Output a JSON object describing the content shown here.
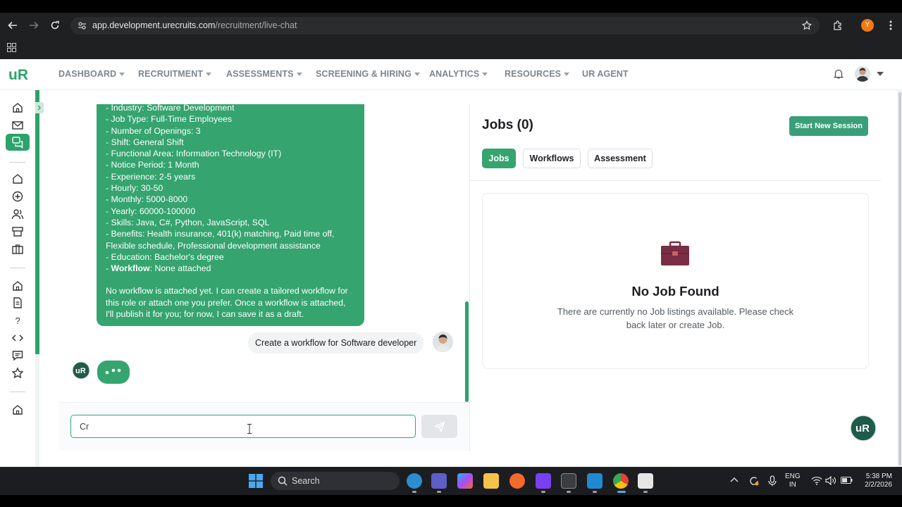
{
  "browser": {
    "url_host": "app.development.urecruits.com",
    "url_path": "/recruitment/live-chat",
    "profile_initial": "Y"
  },
  "nav": {
    "items": [
      {
        "label": "DASHBOARD"
      },
      {
        "label": "RECRUITMENT"
      },
      {
        "label": "ASSESSMENTS"
      },
      {
        "label": "SCREENING & HIRING"
      },
      {
        "label": "ANALYTICS"
      },
      {
        "label": "RESOURCES"
      },
      {
        "label": "UR AGENT"
      }
    ]
  },
  "chat": {
    "bubble_lines": [
      "- Industry: Software Development",
      "- Job Type: Full-Time Employees",
      "- Number of Openings: 3",
      "- Shift: General Shift",
      "- Functional Area: Information Technology (IT)",
      "- Notice Period: 1 Month",
      "- Experience: 2-5 years",
      "- Hourly: 30-50",
      "- Monthly: 5000-8000",
      "- Yearly: 60000-100000",
      "- Skills: Java, C#, Python, JavaScript, SQL",
      "- Benefits: Health insurance, 401(k) matching, Paid time off,",
      "Flexible schedule, Professional development assistance",
      "- Education: Bachelor's degree"
    ],
    "workflow_prefix": "- ",
    "workflow_key": "Workflow",
    "workflow_value": ": None attached",
    "bubble_paragraph": "No workflow is attached yet. I can create a tailored workflow for this role or attach one you prefer. Once a workflow is attached, I'll publish it for you; for now, I can save it as a draft.",
    "user_message": "Create a workflow for Software developer",
    "input_value": "Cr"
  },
  "jobs": {
    "title": "Jobs (0)",
    "new_session_label": "Start New Session",
    "tabs": [
      "Jobs",
      "Workflows",
      "Assessment"
    ],
    "active_tab": "Jobs",
    "empty_title": "No Job Found",
    "empty_desc": "There are currently no Job listings available. Please check back later or create Job."
  },
  "taskbar": {
    "search_label": "Search",
    "lang_1": "ENG",
    "lang_2": "IN",
    "time": "5:38 PM",
    "date": "2/2/2026"
  },
  "colors": {
    "brand_green": "#35a46f",
    "button_green": "#3a9f79",
    "briefcase": "#7a2e45"
  }
}
